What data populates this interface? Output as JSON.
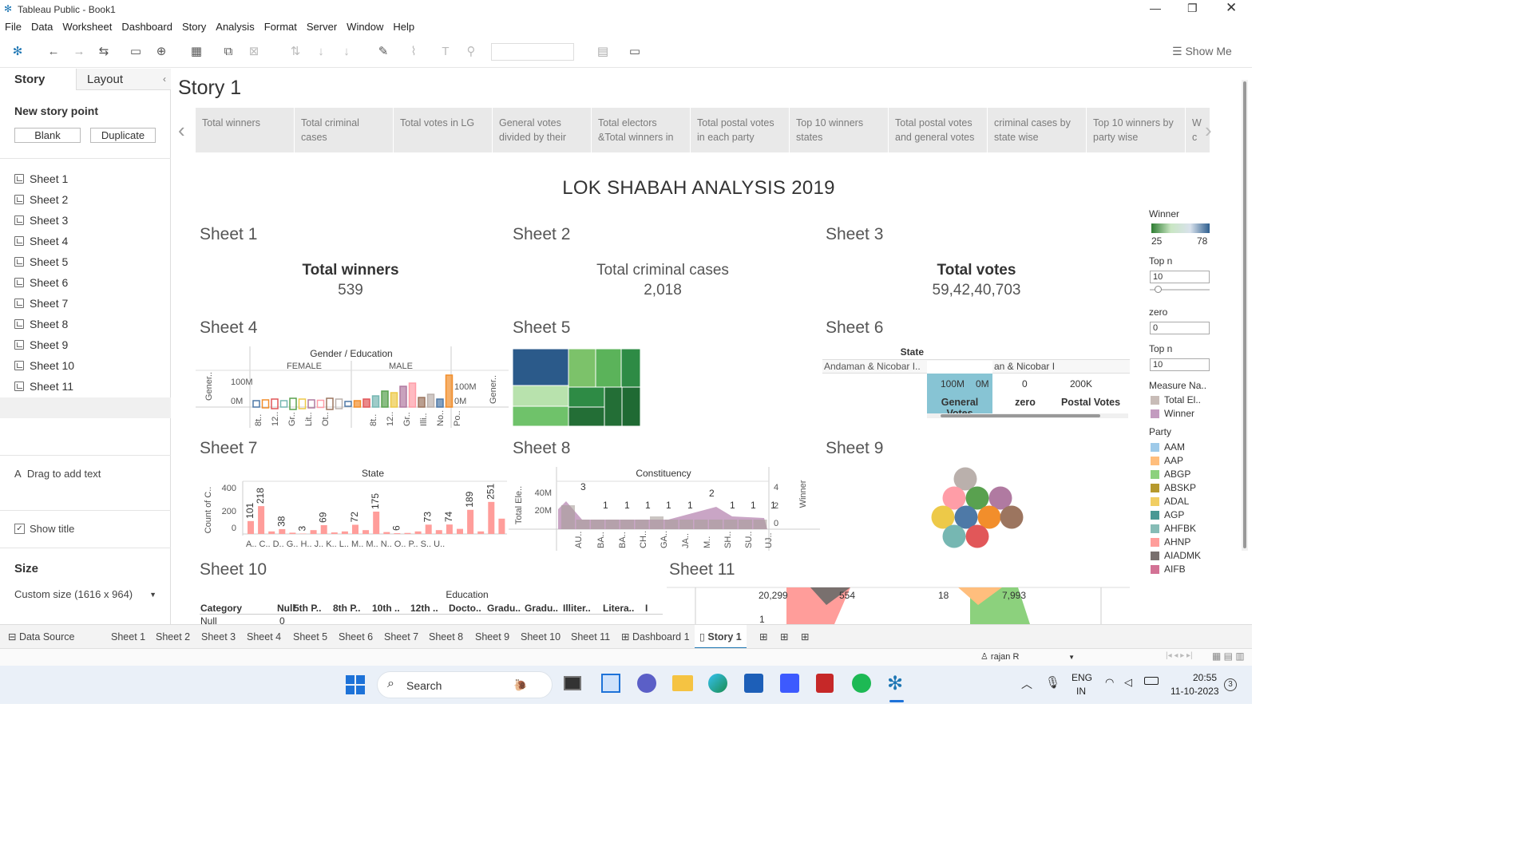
{
  "window": {
    "title": "Tableau Public - Book1"
  },
  "menu": [
    "File",
    "Data",
    "Worksheet",
    "Dashboard",
    "Story",
    "Analysis",
    "Format",
    "Server",
    "Window",
    "Help"
  ],
  "toolbar": {
    "show_me": "Show Me"
  },
  "left": {
    "tab_story": "Story",
    "tab_layout": "Layout",
    "new_story_point": "New story point",
    "blank": "Blank",
    "duplicate": "Duplicate",
    "sheets": [
      "Sheet 1",
      "Sheet 2",
      "Sheet 3",
      "Sheet 4",
      "Sheet 5",
      "Sheet 6",
      "Sheet 7",
      "Sheet 8",
      "Sheet 9",
      "Sheet 10",
      "Sheet 11",
      "Dashboard 1"
    ],
    "drag_text": "Drag to add text",
    "show_title": "Show title",
    "size_label": "Size",
    "size_value": "Custom size (1616 x 964)"
  },
  "story": {
    "title": "Story 1",
    "points": [
      "Total winners",
      "Total criminal cases",
      "Total votes in LG",
      "General votes divided by their",
      "Total electors &Total winners in",
      "Total postal votes in each party",
      "Top 10 winners states",
      "Total postal votes and general votes",
      "criminal cases by state wise",
      "Top 10 winners by party wise",
      "W c"
    ],
    "dashboard_title": "LOK SHABAH ANALYSIS 2019"
  },
  "sheets": {
    "s1": {
      "title": "Sheet 1",
      "label": "Total winners",
      "value": "539"
    },
    "s2": {
      "title": "Sheet 2",
      "label": "Total criminal cases",
      "value": "2,018"
    },
    "s3": {
      "title": "Sheet 3",
      "label": "Total votes",
      "value": "59,42,40,703"
    },
    "s4": {
      "title": "Sheet 4",
      "header": "Gender / Education",
      "female": "FEMALE",
      "male": "MALE",
      "yl": "Gener..",
      "yr": "Gener..",
      "t1": "100M",
      "t0": "0M"
    },
    "s5": {
      "title": "Sheet 5"
    },
    "s6": {
      "title": "Sheet 6",
      "state": "State",
      "row": "Andaman & Nicobar I..",
      "row2": "an & Nicobar I",
      "gv": "General Votes",
      "zero": "zero",
      "pv": "Postal Votes",
      "g1": "100M",
      "g0": "0M",
      "z0": "0",
      "p1": "200K"
    },
    "s7": {
      "title": "Sheet 7",
      "header": "State",
      "ylabel": "Count of C..",
      "ticks": [
        "400",
        "200",
        "0"
      ],
      "labels": [
        "101",
        "218",
        "38",
        "3",
        "69",
        "72",
        "175",
        "6",
        "73",
        "74",
        "189",
        "251"
      ],
      "xticks": "A.. C.. D.. G.. H.. J.. K.. L.. M.. M.. N.. O.. P.. S.. U.."
    },
    "s8": {
      "title": "Sheet 8",
      "header": "Constituency",
      "ylabel": "Total Ele..",
      "yr": "Winner",
      "t40": "40M",
      "t20": "20M",
      "r4": "4",
      "r2": "2",
      "r0": "0",
      "labels": [
        "3",
        "1",
        "1",
        "1",
        "1",
        "1",
        "2",
        "1",
        "1",
        "1"
      ],
      "xticks": [
        "AU..",
        "BA..",
        "BA..",
        "CH..",
        "GA..",
        "JA..",
        "M..",
        "SH..",
        "SU..",
        "UJ.."
      ]
    },
    "s9": {
      "title": "Sheet 9"
    },
    "s10": {
      "title": "Sheet 10",
      "header": "Education",
      "cat": "Category",
      "cols": [
        "Null",
        "5th P..",
        "8th P..",
        "10th ..",
        "12th ..",
        "Docto..",
        "Gradu..",
        "Gradu..",
        "Illiter..",
        "Litera..",
        "I"
      ],
      "row": "Null",
      "val": "0"
    },
    "s11": {
      "title": "Sheet 11",
      "v1": "20,299",
      "v2": "554",
      "v3": "18",
      "v4": "7,993",
      "v5": "1"
    }
  },
  "legend": {
    "winner": "Winner",
    "wmin": "25",
    "wmax": "78",
    "topn": "Top n",
    "topn_val": "10",
    "zero": "zero",
    "zero_val": "0",
    "topn2": "Top n",
    "topn2_val": "10",
    "measure": "Measure Na..",
    "measures": [
      "Total El..",
      "Winner"
    ],
    "party": "Party",
    "parties": [
      {
        "n": "AAM",
        "c": "#9ecae9"
      },
      {
        "n": "AAP",
        "c": "#ffbe7d"
      },
      {
        "n": "ABGP",
        "c": "#8cd17d"
      },
      {
        "n": "ABSKP",
        "c": "#b6992d"
      },
      {
        "n": "ADAL",
        "c": "#f1ce63"
      },
      {
        "n": "AGP",
        "c": "#499894"
      },
      {
        "n": "AHFBK",
        "c": "#86bcb6"
      },
      {
        "n": "AHNP",
        "c": "#ff9d9a"
      },
      {
        "n": "AIADMK",
        "c": "#79706e"
      },
      {
        "n": "AIFB",
        "c": "#d37295"
      }
    ]
  },
  "bottom_tabs": [
    "Data Source",
    "Sheet 1",
    "Sheet 2",
    "Sheet 3",
    "Sheet 4",
    "Sheet 5",
    "Sheet 6",
    "Sheet 7",
    "Sheet 8",
    "Sheet 9",
    "Sheet 10",
    "Sheet 11",
    "Dashboard 1",
    "Story 1"
  ],
  "status": {
    "user": "rajan R"
  },
  "taskbar": {
    "search": "Search",
    "lang1": "ENG",
    "lang2": "IN",
    "time": "20:55",
    "date": "11-10-2023",
    "notif": "3"
  }
}
